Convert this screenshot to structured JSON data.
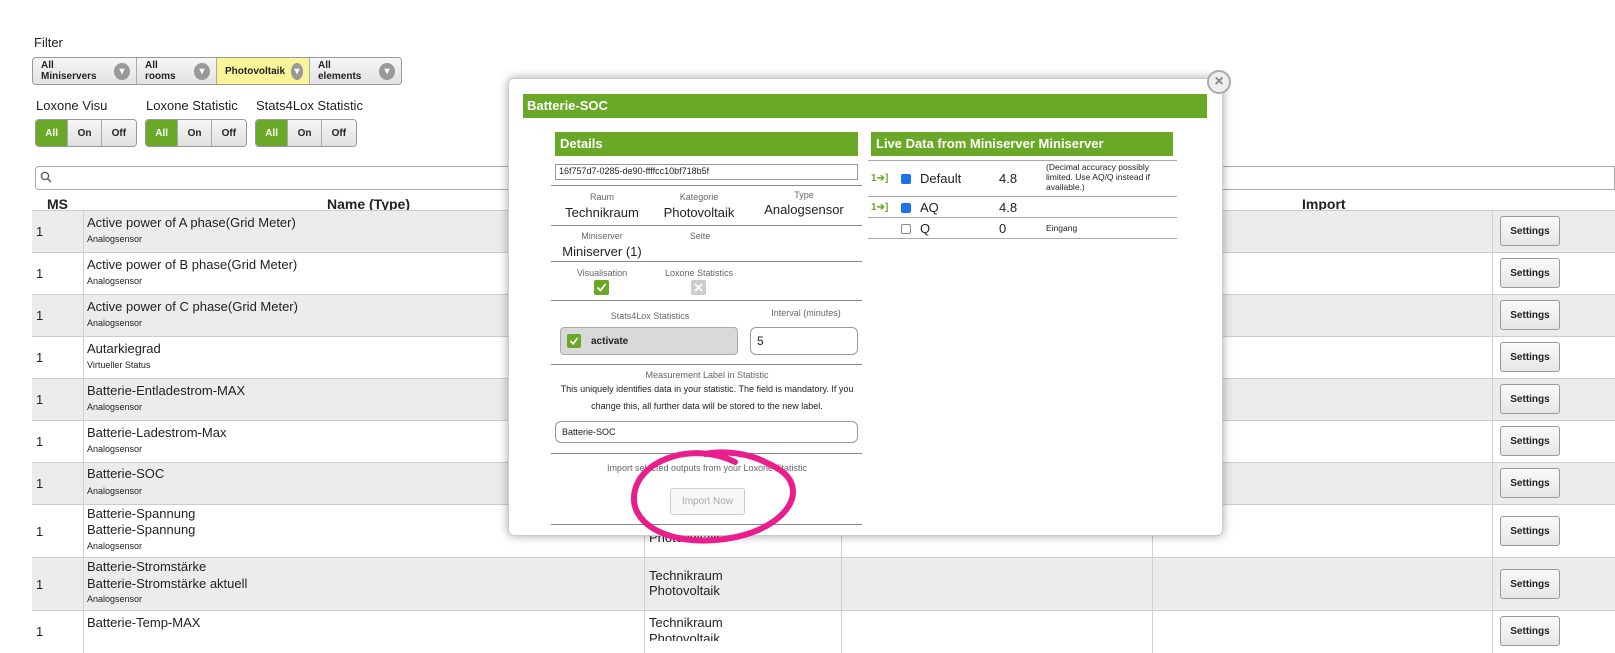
{
  "filter": {
    "label": "Filter",
    "buttons": [
      "All Miniservers",
      "All rooms",
      "Photovoltaik",
      "All elements"
    ]
  },
  "groups": [
    {
      "label": "Loxone Visu",
      "options": [
        "All",
        "On",
        "Off"
      ]
    },
    {
      "label": "Loxone Statistic",
      "options": [
        "All",
        "On",
        "Off"
      ]
    },
    {
      "label": "Stats4Lox Statistic",
      "options": [
        "All",
        "On",
        "Off"
      ]
    }
  ],
  "table": {
    "headers": {
      "ms": "MS",
      "name": "Name (Type)",
      "import": "Import"
    },
    "settings_label": "Settings",
    "rows": [
      {
        "ms": "1",
        "name": "Active power of A phase(Grid Meter)",
        "type": "Analogsensor"
      },
      {
        "ms": "1",
        "name": "Active power of B phase(Grid Meter)",
        "type": "Analogsensor"
      },
      {
        "ms": "1",
        "name": "Active power of C phase(Grid Meter)",
        "type": "Analogsensor"
      },
      {
        "ms": "1",
        "name": "Autarkiegrad",
        "type": "Virtueller Status"
      },
      {
        "ms": "1",
        "name": "Batterie-Entladestrom-MAX",
        "type": "Analogsensor"
      },
      {
        "ms": "1",
        "name": "Batterie-Ladestrom-Max",
        "type": "Analogsensor"
      },
      {
        "ms": "1",
        "name": "Batterie-SOC",
        "type": "Analogsensor"
      },
      {
        "ms": "1",
        "name": "Batterie-Spannung",
        "name2": "Batterie-Spannung",
        "type": "Analogsensor",
        "room_tail": "Photovoltaik"
      },
      {
        "ms": "1",
        "name": "Batterie-Stromstärke",
        "name2": "Batterie-Stromstärke aktuell",
        "type": "Analogsensor",
        "room": "Technikraum",
        "category": "Photovoltaik"
      },
      {
        "ms": "1",
        "name": "Batterie-Temp-MAX",
        "room": "Technikraum",
        "category_partial": "Photovoltaik"
      }
    ]
  },
  "dialog": {
    "title": "Batterie-SOC",
    "details_head": "Details",
    "uuid": "16f757d7-0285-de90-ffffcc10bf718b5f",
    "raum_label": "Raum",
    "raum_value": "Technikraum",
    "kategorie_label": "Kategorie",
    "kategorie_value": "Photovoltaik",
    "type_label": "Type",
    "type_value": "Analogsensor",
    "miniserver_label": "Miniserver",
    "miniserver_value": "Miniserver (1)",
    "seite_label": "Seite",
    "visualisation_label": "Visualisation",
    "loxone_stats_label": "Loxone Statistics",
    "s4l_label": "Stats4Lox Statistics",
    "interval_label": "Interval (minutes)",
    "activate_label": "activate",
    "interval_value": "5",
    "measurement_label": "Measurement Label in Statistic",
    "measurement_desc1": "This uniquely identifies data in your statistic. The field is mandatory. If you",
    "measurement_desc2": "change this, all further data will be stored to the new label.",
    "measurement_value": "Batterie-SOC",
    "import_desc": "Import selected outputs from your Loxone Statistic",
    "import_btn": "Import Now",
    "live_head": "Live Data from Miniserver Miniserver",
    "live_rows": [
      {
        "name": "Default",
        "value": "4.8",
        "note": "(Decimal accuracy possibly limited. Use AQ/Q instead if available.)",
        "checked": true,
        "linked": true
      },
      {
        "name": "AQ",
        "value": "4.8",
        "note": "",
        "checked": true,
        "linked": true
      },
      {
        "name": "Q",
        "value": "0",
        "note": "Eingang",
        "checked": false,
        "linked": false
      }
    ],
    "link_glyph": "1➔]"
  },
  "colors": {
    "green": "#6aa827",
    "highlight": "#e91e8c",
    "filter_active": "#fbf59a"
  }
}
